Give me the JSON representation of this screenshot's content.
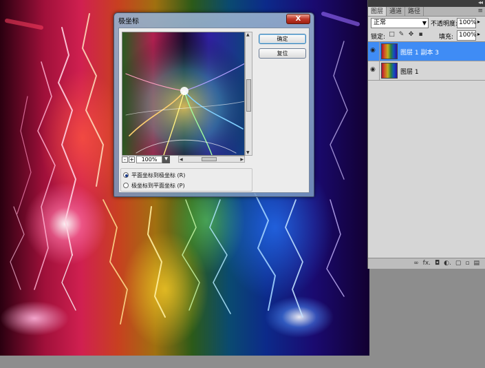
{
  "dialog": {
    "title": "极坐标",
    "close_label": "X",
    "ok_label": "确定",
    "reset_label": "复位",
    "zoom_value": "100%",
    "zoom_out": "-",
    "zoom_in": "+",
    "options": [
      {
        "label": "平面坐标到极坐标 (R)",
        "checked": true
      },
      {
        "label": "极坐标到平面坐标 (P)",
        "checked": false
      }
    ]
  },
  "layers_panel": {
    "tabs": [
      "图层",
      "通道",
      "路径"
    ],
    "active_tab": "图层",
    "collapse_glyph": "◂◂",
    "menu_glyph": "≡",
    "blend_mode": "正常",
    "opacity_label": "不透明度:",
    "opacity_value": "100%",
    "lock_label": "锁定:",
    "fill_label": "填充:",
    "fill_value": "100%",
    "layers": [
      {
        "name": "图层 1 副本 3",
        "selected": true
      },
      {
        "name": "图层 1",
        "selected": false
      }
    ],
    "footer_icons": [
      "link-icon",
      "fx-icon",
      "mask-icon",
      "adjustment-icon",
      "group-icon",
      "new-layer-icon",
      "trash-icon"
    ],
    "footer_glyphs": [
      "∞",
      "fx.",
      "◘",
      "◐.",
      "▢",
      "▫",
      "▤"
    ]
  },
  "colors": {
    "selection": "#3f8cf5",
    "dialog_frame": "#7896be",
    "close_button": "#c0382a"
  }
}
